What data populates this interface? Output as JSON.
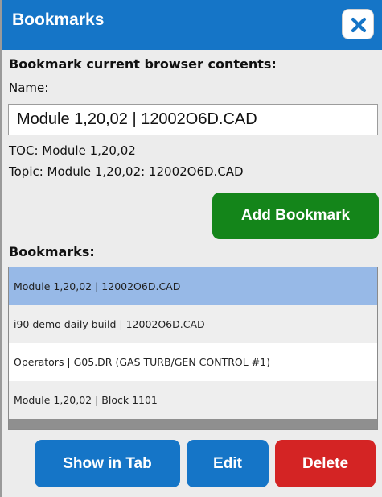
{
  "dialog": {
    "title": "Bookmarks",
    "close_icon": "close-icon"
  },
  "form": {
    "heading": "Bookmark current browser contents:",
    "name_label": "Name:",
    "name_value": "Module 1,20,02 | 12002O6D.CAD",
    "toc_text": "TOC: Module 1,20,02",
    "topic_text": "Topic: Module 1,20,02: 12002O6D.CAD",
    "add_button_label": "Add Bookmark"
  },
  "bookmarks": {
    "label": "Bookmarks:",
    "items": [
      {
        "text": "Module 1,20,02 | 12002O6D.CAD",
        "selected": true
      },
      {
        "text": "i90 demo daily build | 12002O6D.CAD",
        "selected": false
      },
      {
        "text": "Operators | G05.DR (GAS TURB/GEN CONTROL #1)",
        "selected": false
      },
      {
        "text": "Module 1,20,02 | Block 1101",
        "selected": false
      }
    ]
  },
  "actions": {
    "show_in_tab_label": "Show in Tab",
    "edit_label": "Edit",
    "delete_label": "Delete"
  },
  "colors": {
    "titlebar": "#1575c7",
    "add_button": "#14851a",
    "primary_button": "#1575c7",
    "delete_button": "#d42424",
    "selected_row": "#97b9e7"
  }
}
